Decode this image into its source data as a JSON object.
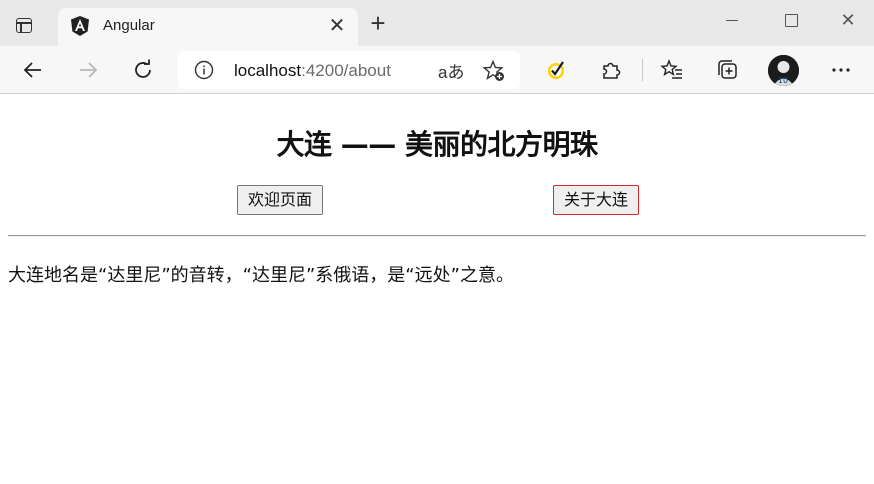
{
  "browser": {
    "tab": {
      "title": "Angular",
      "favicon": "angular-logo-icon"
    },
    "address": {
      "host": "localhost",
      "rest": ":4200/about",
      "read_aloud": "aあ"
    },
    "icons": [
      "tab-actions-icon",
      "back-icon",
      "forward-icon",
      "refresh-icon",
      "info-icon",
      "read-aloud-icon",
      "add-favorite-icon",
      "norton-check-icon",
      "extensions-icon",
      "favorites-icon",
      "collections-icon",
      "profile-avatar",
      "more-icon"
    ]
  },
  "page": {
    "title": "大连 —— 美丽的北方明珠",
    "nav": [
      {
        "label": "欢迎页面",
        "active": false
      },
      {
        "label": "关于大连",
        "active": true
      }
    ],
    "content": "大连地名是“达里尼”的音转，“达里尼”系俄语，是“远处”之意。"
  },
  "colors": {
    "active_border": "#d62a2a",
    "tabstrip": "#e8e8e8",
    "toolbar": "#f7f7f7"
  }
}
